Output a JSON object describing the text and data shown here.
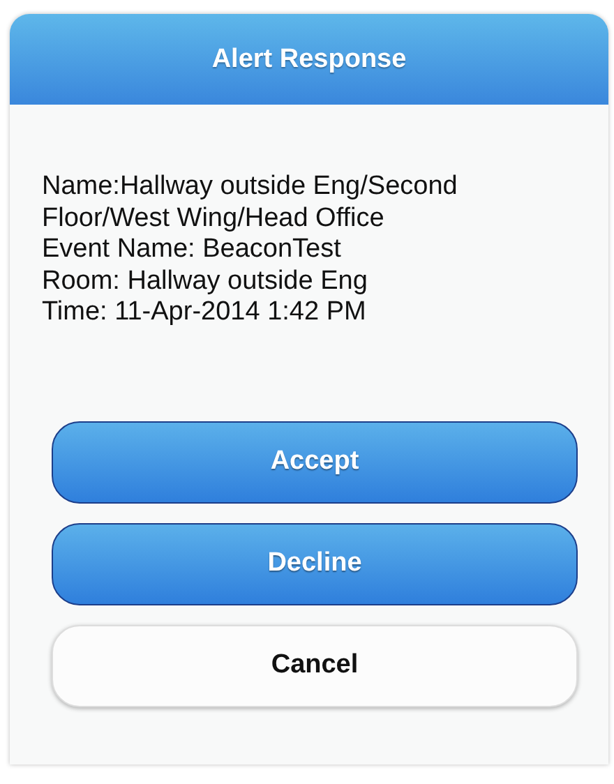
{
  "dialog": {
    "title": "Alert Response",
    "details": [
      "Name:Hallway outside Eng/Second Floor/West Wing/Head Office",
      "Event Name: BeaconTest",
      "Room: Hallway outside Eng",
      "Time: 11-Apr-2014 1:42 PM"
    ],
    "buttons": [
      {
        "label": "Accept",
        "kind": "primary"
      },
      {
        "label": "Decline",
        "kind": "primary"
      },
      {
        "label": "Cancel",
        "kind": "secondary"
      }
    ]
  }
}
